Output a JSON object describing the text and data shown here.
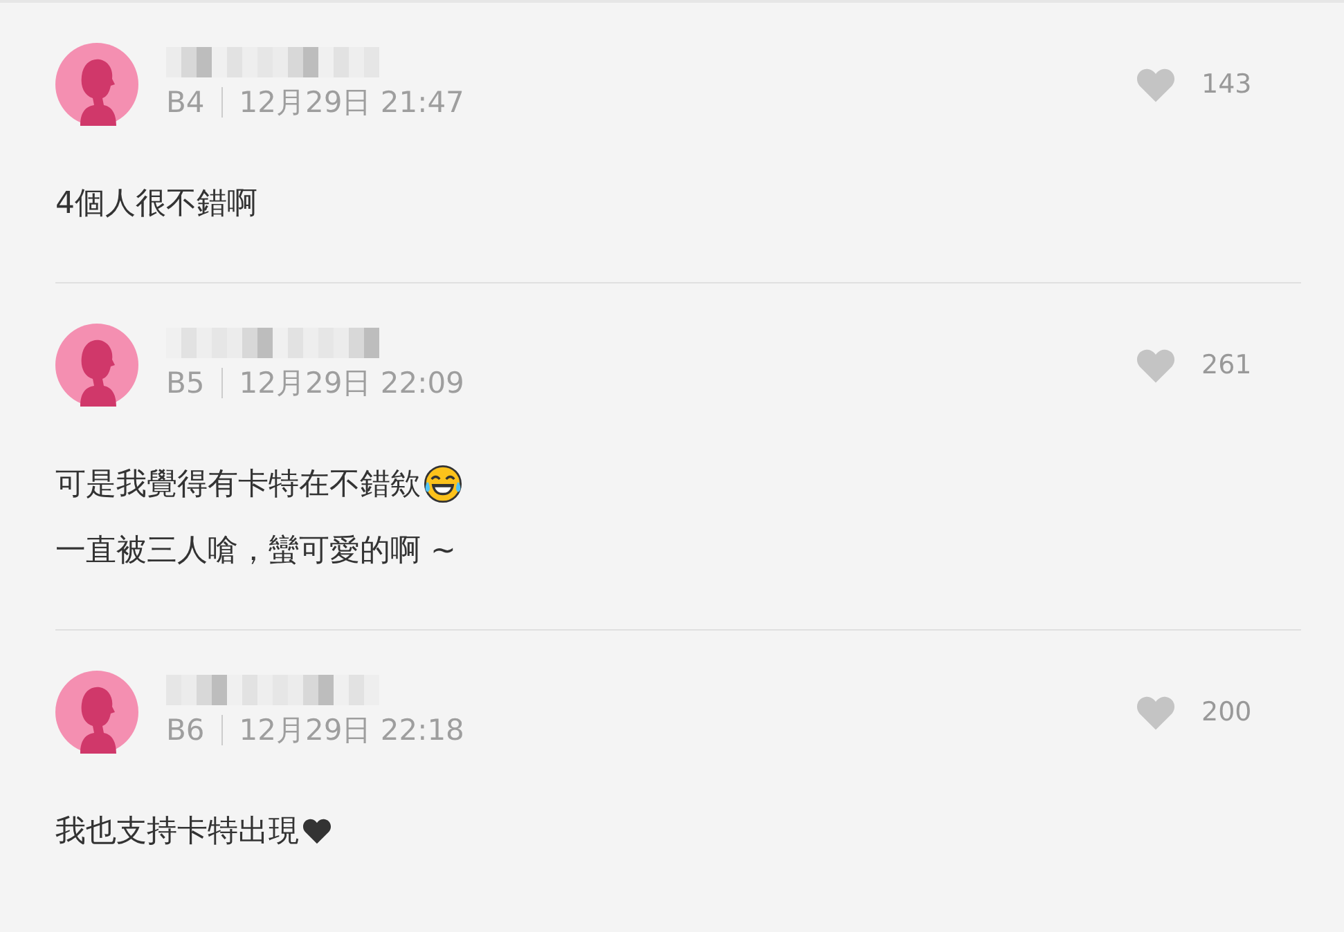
{
  "comments": [
    {
      "floor": "B4",
      "time": "12月29日 21:47",
      "likes": "143",
      "lines": [
        {
          "text": "4個人很不錯啊"
        }
      ]
    },
    {
      "floor": "B5",
      "time": "12月29日 22:09",
      "likes": "261",
      "lines": [
        {
          "text": "可是我覺得有卡特在不錯欸",
          "kind": "laughing"
        },
        {
          "text": "一直被三人嗆，蠻可愛的啊 ~"
        }
      ]
    },
    {
      "floor": "B6",
      "time": "12月29日 22:18",
      "likes": "200",
      "lines": [
        {
          "text": "我也支持卡特出現",
          "kind": "heart"
        }
      ]
    }
  ]
}
